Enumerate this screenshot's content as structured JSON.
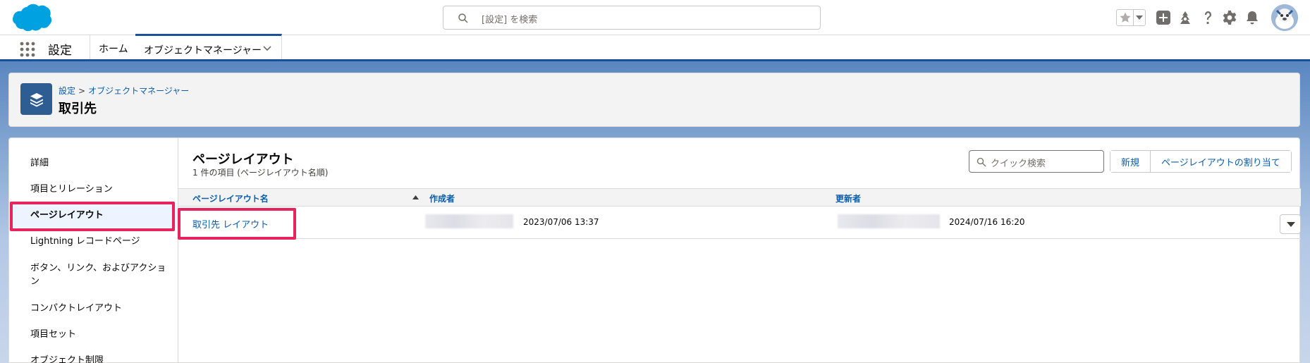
{
  "global_header": {
    "search_placeholder": "[設定] を検索",
    "icons": [
      "cloud-logo",
      "search-icon",
      "star-icon",
      "chevron-down-icon",
      "add-icon",
      "trailhead-icon",
      "help-icon",
      "gear-icon",
      "bell-icon",
      "avatar"
    ]
  },
  "context_bar": {
    "app_name": "設定",
    "tabs": [
      {
        "label": "ホーム"
      },
      {
        "label": "オブジェクトマネージャー"
      }
    ]
  },
  "page_header": {
    "breadcrumb": [
      "設定",
      "オブジェクトマネージャー"
    ],
    "breadcrumb_separator": ">",
    "title": "取引先"
  },
  "sidebar": {
    "items": [
      {
        "label": "詳細"
      },
      {
        "label": "項目とリレーション"
      },
      {
        "label": "ページレイアウト"
      },
      {
        "label": "Lightning レコードページ"
      },
      {
        "label": "ボタン、リンク、およびアクション"
      },
      {
        "label": "コンパクトレイアウト"
      },
      {
        "label": "項目セット"
      },
      {
        "label": "オブジェクト制限"
      }
    ],
    "active_index": 2
  },
  "content": {
    "title": "ページレイアウト",
    "subtitle": "1 件の項目 (ページレイアウト名順)",
    "quick_search_placeholder": "クイック検索",
    "buttons": {
      "new": "新規",
      "assign": "ページレイアウトの割り当て"
    },
    "columns": [
      "ページレイアウト名",
      "作成者",
      "更新者"
    ],
    "rows": [
      {
        "name": "取引先 レイアウト",
        "created_at": "2023/07/06 13:37",
        "updated_at": "2024/07/16 16:20"
      }
    ]
  },
  "colors": {
    "highlight": "#e8245f",
    "link": "#0b5cab",
    "brand": "#1b5297"
  }
}
